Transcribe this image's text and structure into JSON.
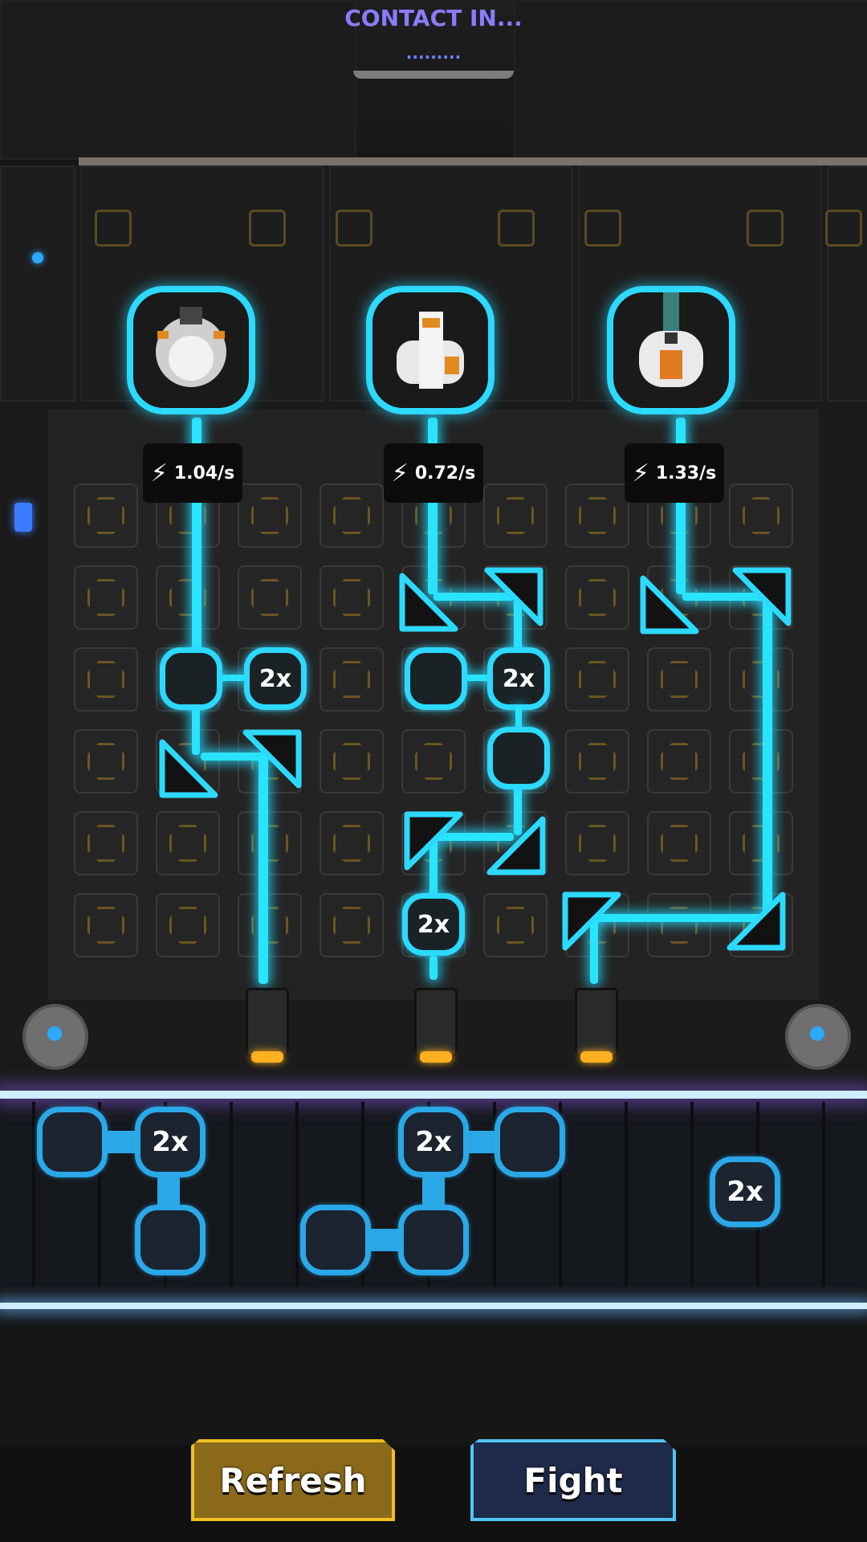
{
  "header": {
    "title": "CONTACT IN...",
    "subtitle": "........."
  },
  "generators": [
    {
      "name": "robot-1",
      "rate": "1.04/s"
    },
    {
      "name": "robot-2",
      "rate": "0.72/s"
    },
    {
      "name": "robot-3",
      "rate": "1.33/s"
    }
  ],
  "board_nodes": {
    "multiplier_label": "2x"
  },
  "tray": {
    "multiplier_label": "2x"
  },
  "buttons": {
    "refresh": "Refresh",
    "fight": "Fight"
  },
  "colors": {
    "energy": "#29e4ff",
    "refresh": "#f0c020",
    "fight": "#4fc6f0",
    "title": "#8a7cff"
  }
}
